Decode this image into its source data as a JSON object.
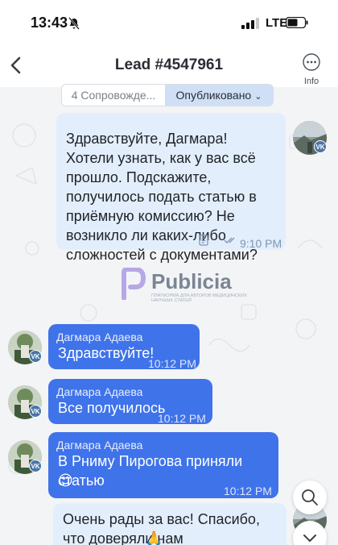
{
  "status_bar": {
    "time": "13:43",
    "network": "LTE"
  },
  "header": {
    "title": "Lead #4547961",
    "info_label": "Info"
  },
  "chips": {
    "first": "4 Сопровожде...",
    "second": "Опубликовано"
  },
  "brand": {
    "name": "Publicia",
    "tagline": "ПЛАТФОРМА ДЛЯ АВТОРОВ МЕДИЦИНСКИХ НАУЧНЫХ СТАТЕЙ"
  },
  "messages": [
    {
      "direction": "out",
      "text": "Здравствуйте, Дагмара! Хотели узнать, как у вас всё прошло. Подскажите, получилось подать статью в приёмную комиссию? Не возникло ли каких-либо сложностей с документами?",
      "time": "9:10 PM"
    },
    {
      "direction": "in",
      "sender": "Дагмара Адаева",
      "text": "Здравствуйте!",
      "time": "10:12 PM"
    },
    {
      "direction": "in",
      "sender": "Дагмара Адаева",
      "text": "Все получилось",
      "time": "10:12 PM"
    },
    {
      "direction": "in",
      "sender": "Дагмара Адаева",
      "text": "В Рниму Пирогова приняли статью",
      "emoji": "😊",
      "time": "10:12 PM"
    },
    {
      "direction": "out",
      "text": "Очень рады за вас! Спасибо, что доверяли нам",
      "emoji": "🙏"
    }
  ],
  "avatar_badge": "VK",
  "colors": {
    "incoming_bubble": "#3f73ea",
    "outgoing_bubble": "#e3eefc",
    "accent_chip": "#cfe0f6"
  }
}
